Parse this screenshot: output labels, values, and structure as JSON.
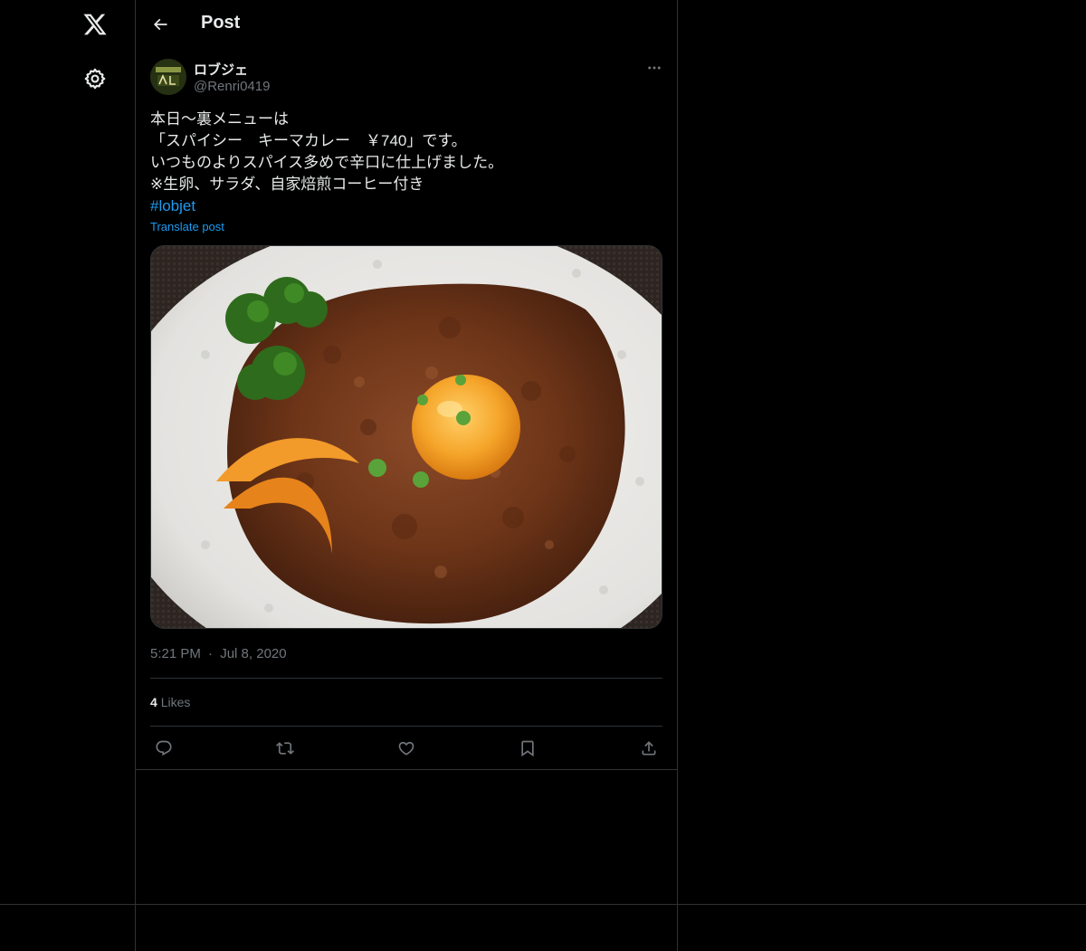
{
  "nav": {
    "logo_icon": "x-logo-icon",
    "settings_icon": "gear-icon"
  },
  "header": {
    "title": "Post",
    "back_icon": "arrow-left-icon"
  },
  "post": {
    "author_name": "ロブジェ",
    "author_handle": "@Renri0419",
    "avatar_text": "Lobjet",
    "text_lines": [
      "本日〜裏メニューは",
      "「スパイシー　キーマカレー　￥740」です。",
      "いつものよりスパイス多めで辛口に仕上げました。",
      "※生卵、サラダ、自家焙煎コーヒー付き"
    ],
    "hashtag": "#lobjet",
    "translate_label": "Translate post",
    "time": "5:21 PM",
    "separator": "·",
    "date": "Jul 8, 2020",
    "likes_count": "4",
    "likes_label": "Likes"
  },
  "colors": {
    "background": "#000000",
    "text": "#e7e9ea",
    "muted": "#71767b",
    "accent": "#1d9bf0",
    "border": "#2f3336"
  }
}
